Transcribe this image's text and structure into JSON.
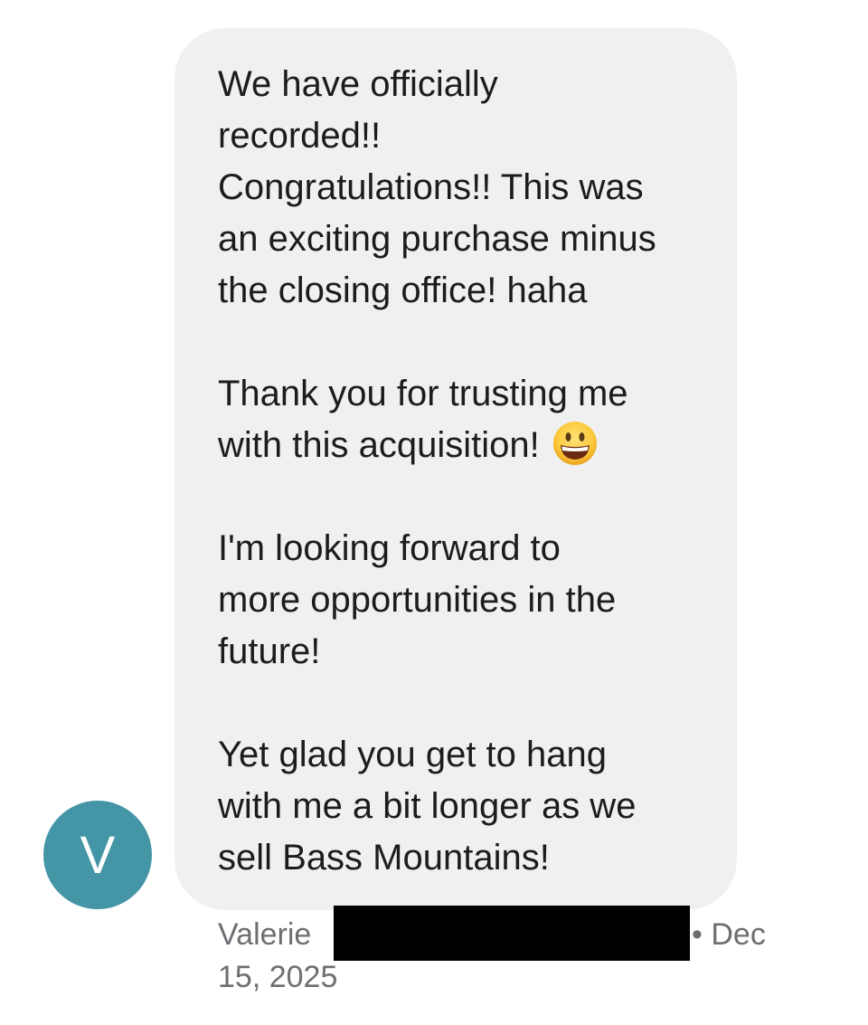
{
  "message": {
    "lines": [
      "We have officially",
      "recorded!!",
      "Congratulations!! This was",
      "an exciting purchase minus",
      "the closing office! haha",
      "",
      "Thank you for trusting me",
      "with this acquisition!",
      "",
      "I'm looking forward to",
      "more opportunities in the",
      "future!",
      "",
      "Yet glad you get to hang",
      "with me a bit longer  as we",
      "sell Bass Mountains!"
    ],
    "emoji_icon": "grinning-face-icon"
  },
  "sender": {
    "avatar_initial": "V",
    "avatar_color": "#4496a7",
    "name": "Valerie",
    "separator_and_date_start": "• Dec",
    "date_end": "15, 2025"
  },
  "colors": {
    "bubble": "#f0f0f0",
    "text": "#1c1c1e",
    "meta_text": "#6e6e73"
  }
}
